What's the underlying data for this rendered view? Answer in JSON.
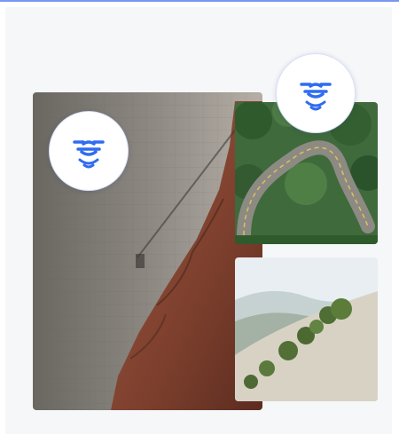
{
  "colors": {
    "accent_line": "#7b95f2",
    "card_background": "#f6f7f9",
    "icon_blue": "#2f6cf0",
    "badge_background": "#ffffff"
  },
  "icons": {
    "left_badge": "drone-signal-icon",
    "right_badge": "drone-signal-icon"
  }
}
